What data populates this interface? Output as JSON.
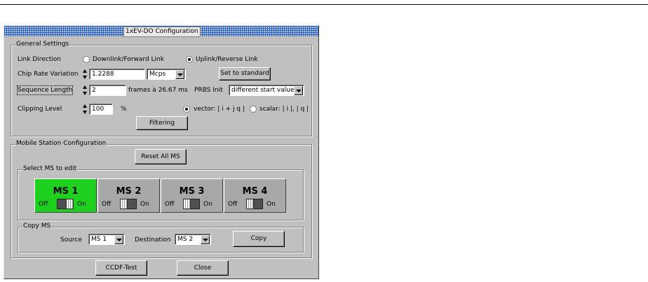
{
  "window": {
    "title": "1xEV-DO Configuration"
  },
  "general": {
    "label": "General Settings",
    "link_direction": {
      "label": "Link Direction",
      "options": [
        "Downlink/Forward Link",
        "Uplink/Reverse Link"
      ],
      "selected": "Uplink/Reverse Link"
    },
    "chip_rate": {
      "label": "Chip Rate Variation",
      "value": "1.2288",
      "unit": "Mcps"
    },
    "set_standard_label": "Set to standard",
    "sequence_length": {
      "label": "Sequence Length",
      "value": "2",
      "unit_text": "frames à 26.67 ms"
    },
    "prbs": {
      "label": "PRBS Init",
      "value": "different start values"
    },
    "clipping": {
      "label": "Clipping Level",
      "value": "100",
      "unit": "%"
    },
    "vector_mode": {
      "options": [
        "vector: | i + j q |",
        "scalar: | i |, | q |"
      ],
      "selected": "vector: | i + j q |"
    },
    "filtering_label": "Filtering"
  },
  "mobile": {
    "label": "Mobile Station Configuration",
    "reset_label": "Reset All MS",
    "select_label": "Select MS to edit",
    "stations": [
      {
        "name": "MS 1",
        "off": "Off",
        "on": "On",
        "state": "on",
        "selected": true
      },
      {
        "name": "MS 2",
        "off": "Off",
        "on": "On",
        "state": "off",
        "selected": false
      },
      {
        "name": "MS 3",
        "off": "Off",
        "on": "On",
        "state": "off",
        "selected": false
      },
      {
        "name": "MS 4",
        "off": "Off",
        "on": "On",
        "state": "off",
        "selected": false
      }
    ],
    "copy": {
      "label": "Copy MS",
      "source_label": "Source",
      "source_value": "MS 1",
      "dest_label": "Destination",
      "dest_value": "MS 2",
      "button_label": "Copy"
    }
  },
  "footer": {
    "ccdf_label": "CCDF-Test",
    "close_label": "Close"
  },
  "colors": {
    "selected_tile": "#1fd11f",
    "tile": "#a8a8a8",
    "titlebar": "#1e64d6"
  }
}
